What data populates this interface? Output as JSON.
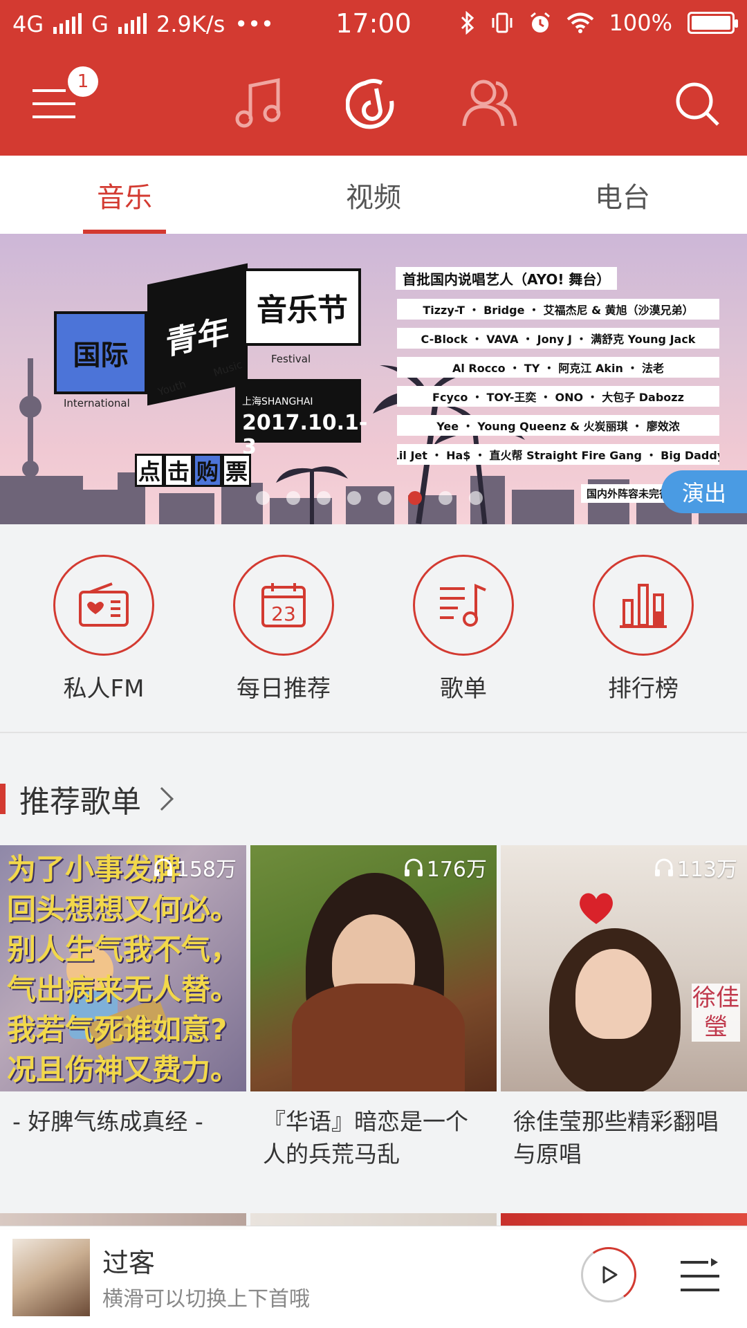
{
  "status_bar": {
    "network1": "4G",
    "network2": "G",
    "speed": "2.9K/s",
    "more": "•••",
    "time": "17:00",
    "battery": "100%"
  },
  "app_bar": {
    "badge_count": "1",
    "icons": [
      "menu-icon",
      "music-note-icon",
      "netease-logo-icon",
      "friends-icon",
      "search-icon"
    ]
  },
  "tabs": [
    {
      "label": "音乐",
      "active": true
    },
    {
      "label": "视频",
      "active": false
    },
    {
      "label": "电台",
      "active": false
    }
  ],
  "banner": {
    "fest_a": "国际",
    "fest_b": "青年",
    "fest_c": "音乐节",
    "sub_international": "International",
    "sub_youth": "Youth",
    "sub_music": "Music",
    "sub_festival": "Festival",
    "city": "上海",
    "city_en": "SHANGHAI",
    "date": "2017.10.1-3",
    "ticket": [
      "点",
      "击",
      "购",
      "票"
    ],
    "lineup_title": "首批国内说唱艺人（AYO! 舞台）",
    "lineup": [
      "Tizzy-T ・ Bridge ・ 艾福杰尼 & 黄旭（沙漠兄弟）",
      "C-Block ・ VAVA ・ Jony J ・ 满舒克 Young Jack",
      "Al Rocco ・ TY ・ 阿克江 Akin ・ 法老",
      "Fcyco ・ TOY-王奕 ・ ONO ・ 大包子 Dabozz",
      "Yee ・ Young Queenz & 火炭丽琪 ・ 廖效浓",
      "Lil Jet ・ Ha$ ・ 直火帮 Straight Fire Gang ・ Big Daddy"
    ],
    "note": "国内外阵容未完待续",
    "tag": "演出",
    "dots_total": 8,
    "dots_active": 5
  },
  "entries": [
    {
      "label": "私人FM",
      "icon": "radio-icon"
    },
    {
      "label": "每日推荐",
      "icon": "calendar-icon",
      "day": "23"
    },
    {
      "label": "歌单",
      "icon": "playlist-icon"
    },
    {
      "label": "排行榜",
      "icon": "chart-bars-icon"
    }
  ],
  "section": {
    "title": "推荐歌单"
  },
  "playlists": [
    {
      "plays": "158万",
      "name": "- 好脾气练成真经 -",
      "cover_lines": [
        "为了小事发脾",
        "回头想想又何必。",
        "别人生气我不气，",
        "气出病来无人替。",
        "我若气死谁如意?",
        "况且伤神又费力。"
      ]
    },
    {
      "plays": "176万",
      "name": "『华语』暗恋是一个人的兵荒马乱"
    },
    {
      "plays": "113万",
      "name": "徐佳莹那些精彩翻唱与原唱",
      "cover_side": "徐佳瑩"
    }
  ],
  "player": {
    "song": "过客",
    "hint": "横滑可以切换上下首哦"
  },
  "colors": {
    "brand_red": "#d33a31",
    "tag_blue": "#4a9be3"
  }
}
